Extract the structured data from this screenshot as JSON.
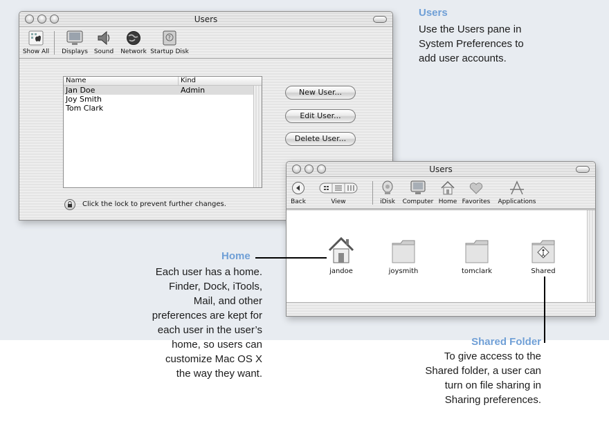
{
  "prefs_window": {
    "title": "Users",
    "toolbar": [
      {
        "label": "Show All",
        "icon": "apple-grid-icon"
      },
      {
        "label": "Displays",
        "icon": "monitor-icon"
      },
      {
        "label": "Sound",
        "icon": "speaker-icon"
      },
      {
        "label": "Network",
        "icon": "globe-icon"
      },
      {
        "label": "Startup Disk",
        "icon": "disk-icon"
      }
    ],
    "list": {
      "columns": [
        "Name",
        "Kind"
      ],
      "rows": [
        {
          "name": "Jan Doe",
          "kind": "Admin"
        },
        {
          "name": "Joy Smith",
          "kind": ""
        },
        {
          "name": "Tom Clark",
          "kind": ""
        }
      ]
    },
    "buttons": {
      "new_user": "New User...",
      "edit_user": "Edit User...",
      "delete_user": "Delete User..."
    },
    "lock_text": "Click the lock to prevent further changes."
  },
  "finder_window": {
    "title": "Users",
    "toolbar": [
      {
        "label": "Back",
        "icon": "back-icon"
      },
      {
        "label": "View",
        "icon": "view-icon"
      },
      {
        "label": "iDisk",
        "icon": "idisk-icon"
      },
      {
        "label": "Computer",
        "icon": "computer-icon"
      },
      {
        "label": "Home",
        "icon": "home-icon"
      },
      {
        "label": "Favorites",
        "icon": "heart-icon"
      },
      {
        "label": "Applications",
        "icon": "applications-icon"
      }
    ],
    "items": [
      {
        "label": "jandoe",
        "icon": "home-icon"
      },
      {
        "label": "joysmith",
        "icon": "folder-icon"
      },
      {
        "label": "tomclark",
        "icon": "folder-icon"
      },
      {
        "label": "Shared",
        "icon": "shared-folder-icon"
      }
    ]
  },
  "callouts": {
    "users": {
      "heading": "Users",
      "body": [
        "Use the Users pane in",
        "System Preferences to",
        "add user accounts."
      ]
    },
    "home": {
      "heading": "Home",
      "body": [
        "Each user has a home.",
        "Finder, Dock, iTools,",
        "Mail, and other",
        "preferences are kept for",
        "each user in the user’s",
        "home, so users can",
        "customize Mac OS X",
        "the way they want."
      ]
    },
    "shared": {
      "heading": "Shared Folder",
      "body": [
        "To give access to the",
        "Shared folder, a user can",
        "turn on file sharing in",
        "Sharing preferences."
      ]
    }
  },
  "colors": {
    "callout_heading": "#6f9fd6",
    "backdrop": "#e8ecf1"
  }
}
